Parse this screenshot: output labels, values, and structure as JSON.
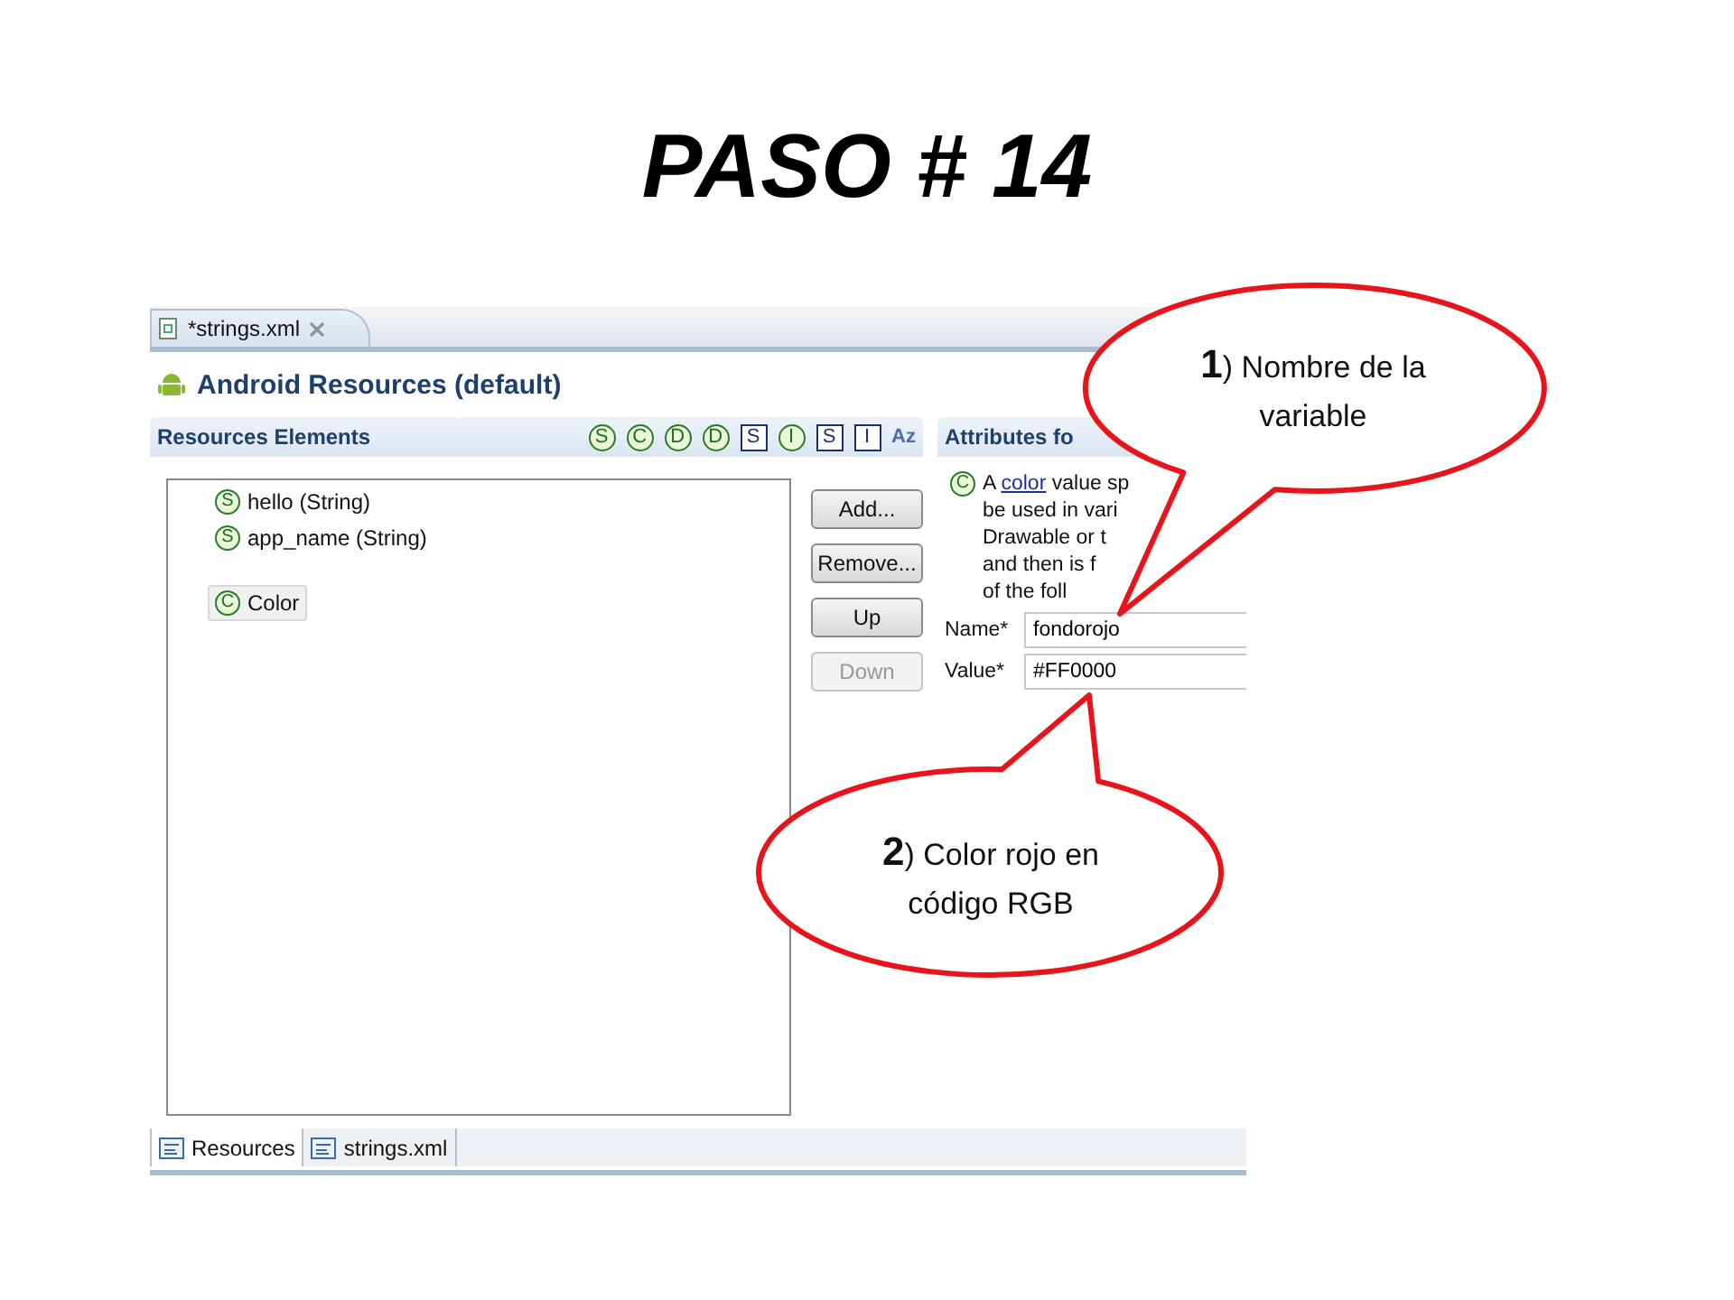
{
  "slide_title": "PASO # 14",
  "editor_tab": {
    "label": "*strings.xml"
  },
  "header": {
    "title": "Android Resources (default)"
  },
  "resources_section": {
    "title": "Resources Elements",
    "toolbar": [
      {
        "kind": "circle",
        "text": "S"
      },
      {
        "kind": "circle",
        "text": "C"
      },
      {
        "kind": "circle",
        "text": "D"
      },
      {
        "kind": "circle",
        "text": "D"
      },
      {
        "kind": "square",
        "text": "S"
      },
      {
        "kind": "circle",
        "text": "I"
      },
      {
        "kind": "square",
        "text": "S"
      },
      {
        "kind": "square",
        "text": "I"
      },
      {
        "kind": "sort",
        "text": "Az"
      }
    ],
    "groups": [
      {
        "items": [
          {
            "icon": "S",
            "label": "hello (String)",
            "selected": false
          },
          {
            "icon": "S",
            "label": "app_name (String)",
            "selected": false
          }
        ]
      },
      {
        "items": [
          {
            "icon": "C",
            "label": "Color",
            "selected": true
          }
        ]
      }
    ],
    "buttons": [
      {
        "label": "Add...",
        "disabled": false
      },
      {
        "label": "Remove...",
        "disabled": false
      },
      {
        "label": "Up",
        "disabled": false
      },
      {
        "label": "Down",
        "disabled": true
      }
    ]
  },
  "attributes_section": {
    "title": "Attributes fo",
    "icon": "C",
    "description": {
      "prefix": "A",
      "link": "color",
      "rest": "value sp",
      "lines": [
        "be used in vari",
        "Drawable or t",
        "and then is f",
        "of the foll"
      ]
    },
    "fields": [
      {
        "label": "Name*",
        "value": "fondorojo"
      },
      {
        "label": "Value*",
        "value": "#FF0000"
      }
    ]
  },
  "bottom_tabs": [
    {
      "label": "Resources",
      "selected": true
    },
    {
      "label": "strings.xml",
      "selected": false
    }
  ],
  "callouts": [
    {
      "text": "**1**) Nombre de la variable"
    },
    {
      "text": "**2**) Color  rojo  en código  RGB"
    }
  ]
}
